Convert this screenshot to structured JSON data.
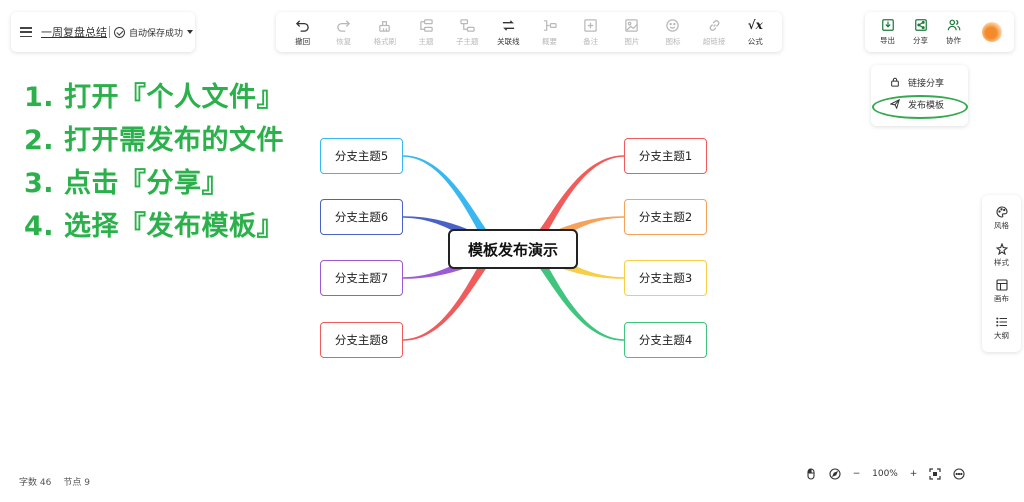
{
  "header": {
    "doc_title": "一周复盘总结",
    "save_status": "自动保存成功"
  },
  "toolbar": {
    "items": [
      {
        "label": "撤回",
        "icon": "undo-icon"
      },
      {
        "label": "恢复",
        "icon": "redo-icon"
      },
      {
        "label": "格式刷",
        "icon": "format-brush-icon"
      },
      {
        "label": "主题",
        "icon": "topic-icon"
      },
      {
        "label": "子主题",
        "icon": "subtopic-icon"
      },
      {
        "label": "关联线",
        "icon": "relation-line-icon"
      },
      {
        "label": "概要",
        "icon": "summary-icon"
      },
      {
        "label": "备注",
        "icon": "note-icon"
      },
      {
        "label": "图片",
        "icon": "image-icon"
      },
      {
        "label": "图标",
        "icon": "emoji-icon"
      },
      {
        "label": "超链接",
        "icon": "link-icon"
      },
      {
        "label": "公式",
        "icon": "formula-icon",
        "glyph": "√x"
      }
    ]
  },
  "right_top": {
    "export_label": "导出",
    "share_label": "分享",
    "collab_label": "协作"
  },
  "share_menu": {
    "link_share": "链接分享",
    "publish_template": "发布模板"
  },
  "steps": [
    "1. 打开『个人文件』",
    "2. 打开需发布的文件",
    "3. 点击『分享』",
    "4. 选择『发布模板』"
  ],
  "mindmap": {
    "root": "模板发布演示",
    "branches": [
      {
        "label": "分支主题1",
        "color": "#f05b5b"
      },
      {
        "label": "分支主题2",
        "color": "#f7a25a"
      },
      {
        "label": "分支主题3",
        "color": "#f7cf45"
      },
      {
        "label": "分支主题4",
        "color": "#3fc57d"
      },
      {
        "label": "分支主题5",
        "color": "#3ab7f0"
      },
      {
        "label": "分支主题6",
        "color": "#4a62c6"
      },
      {
        "label": "分支主题7",
        "color": "#9b5ad6"
      },
      {
        "label": "分支主题8",
        "color": "#f05b5b"
      }
    ]
  },
  "side_panel": {
    "style_label": "风格",
    "format_label": "样式",
    "canvas_label": "画布",
    "outline_label": "大纲"
  },
  "stats": {
    "word_count": "字数 46",
    "node_count": "节点 9"
  },
  "zoom": {
    "minus": "−",
    "level": "100%",
    "plus": "+"
  }
}
